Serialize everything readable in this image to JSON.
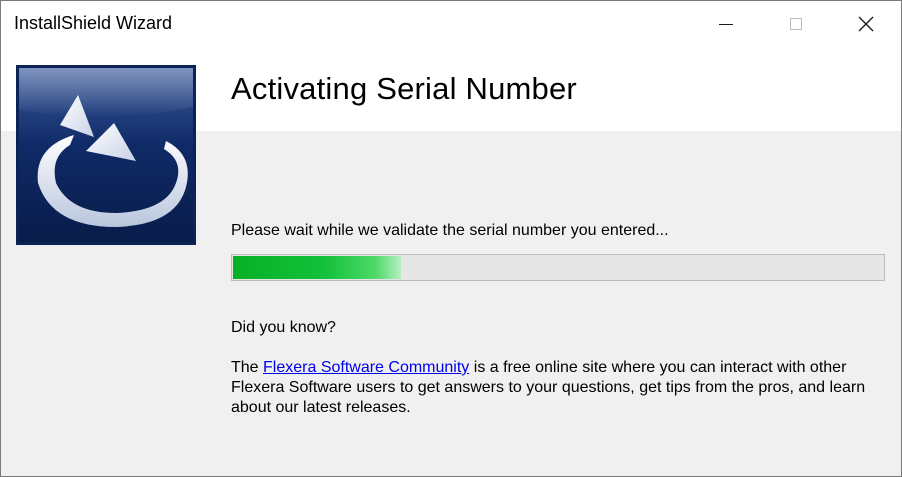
{
  "window": {
    "title": "InstallShield Wizard"
  },
  "title_controls": {
    "minimize": "minimize",
    "maximize": "maximize",
    "close": "close"
  },
  "header": {
    "title": "Activating Serial Number"
  },
  "status": {
    "text": "Please wait while we validate the serial number you entered...",
    "progress_percent": 26
  },
  "tip": {
    "heading": "Did you know?",
    "prefix": "The ",
    "link_text": "Flexera Software Community",
    "suffix": " is a free online site where you can interact with other Flexera Software users to get answers to your questions, get tips from the pros, and learn about our latest releases."
  },
  "colors": {
    "progress_green": "#06b025",
    "logo_navy": "#0c2358",
    "link_blue": "#0000ee"
  }
}
